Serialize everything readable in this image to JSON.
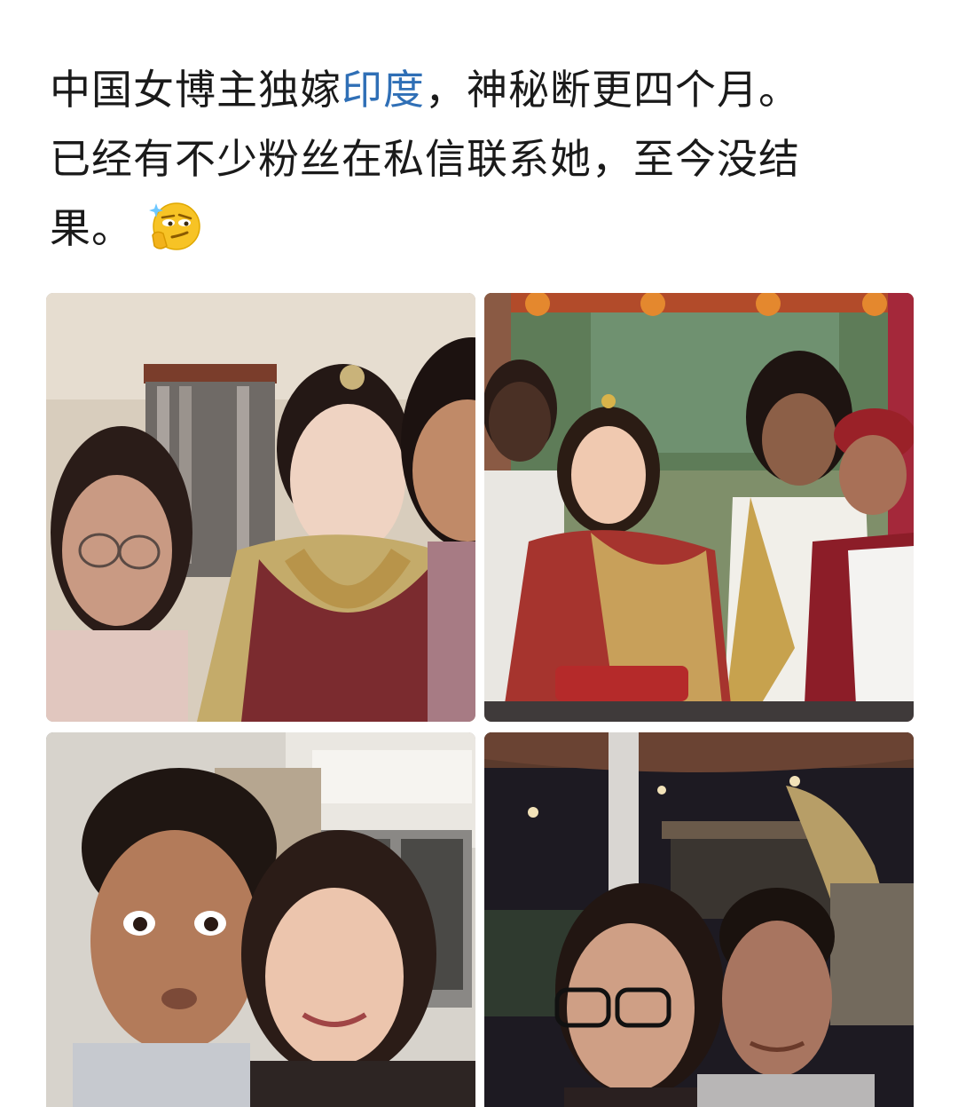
{
  "post": {
    "text_line_1_a": "中国女博主独嫁",
    "text_link": "印度",
    "text_line_1_b": "，神秘断更四个月。",
    "text_line_2": "已经有不少粉丝在私信联系她，至今没结",
    "text_line_3": "果。",
    "emoji": "thinking-smirk-emoji",
    "link_color": "#2f6fb6",
    "text_color": "#1a1a1a"
  },
  "photos": [
    {
      "name": "wedding-selfie-indoor"
    },
    {
      "name": "wedding-group-photo"
    },
    {
      "name": "couple-selfie-indoor"
    },
    {
      "name": "couple-selfie-night"
    }
  ]
}
